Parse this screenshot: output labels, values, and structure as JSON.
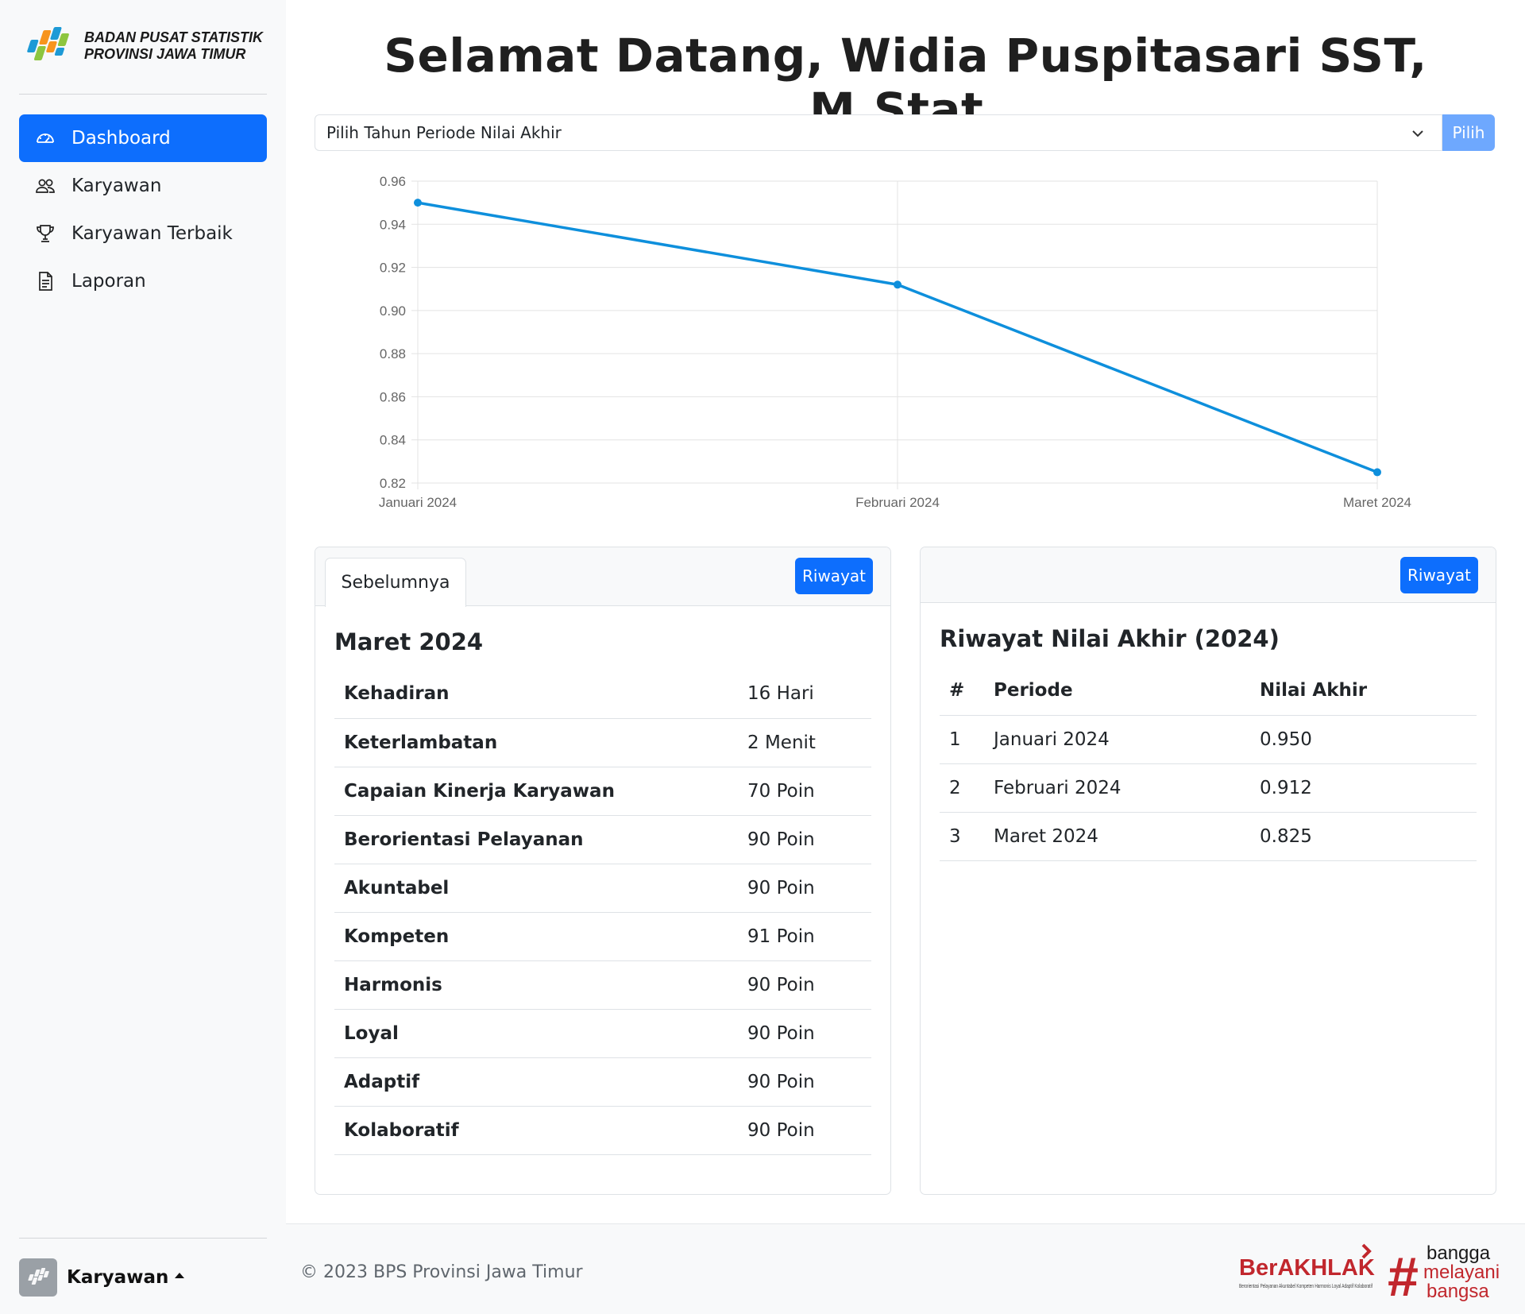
{
  "sidebar": {
    "brand_line1": "BADAN PUSAT STATISTIK",
    "brand_line2": "PROVINSI JAWA TIMUR",
    "nav": [
      {
        "label": "Dashboard",
        "icon": "speedometer-icon",
        "active": true
      },
      {
        "label": "Karyawan",
        "icon": "people-icon",
        "active": false
      },
      {
        "label": "Karyawan Terbaik",
        "icon": "trophy-icon",
        "active": false
      },
      {
        "label": "Laporan",
        "icon": "file-text-icon",
        "active": false
      }
    ],
    "user_label": "Karyawan"
  },
  "header": {
    "title": "Selamat Datang, Widia Puspitasari SST, M.Stat,"
  },
  "period_select": {
    "value": "Pilih Tahun Periode Nilai Akhir",
    "button_label": "Pilih"
  },
  "chart_data": {
    "type": "line",
    "categories": [
      "Januari 2024",
      "Februari 2024",
      "Maret 2024"
    ],
    "series": [
      {
        "values": [
          0.95,
          0.912,
          0.825
        ],
        "color": "#0e8fdc"
      }
    ],
    "yticks": [
      "0.96",
      "0.94",
      "0.92",
      "0.90",
      "0.88",
      "0.86",
      "0.84",
      "0.82"
    ],
    "ylim": [
      0.82,
      0.96
    ],
    "grid": true
  },
  "current_card": {
    "tab_label": "Sebelumnya",
    "button_label": "Riwayat",
    "title": "Maret 2024",
    "rows": [
      {
        "label": "Kehadiran",
        "value": "16 Hari"
      },
      {
        "label": "Keterlambatan",
        "value": "2 Menit"
      },
      {
        "label": "Capaian Kinerja Karyawan",
        "value": "70 Poin"
      },
      {
        "label": "Berorientasi Pelayanan",
        "value": "90 Poin"
      },
      {
        "label": "Akuntabel",
        "value": "90 Poin"
      },
      {
        "label": "Kompeten",
        "value": "91 Poin"
      },
      {
        "label": "Harmonis",
        "value": "90 Poin"
      },
      {
        "label": "Loyal",
        "value": "90 Poin"
      },
      {
        "label": "Adaptif",
        "value": "90 Poin"
      },
      {
        "label": "Kolaboratif",
        "value": "90 Poin"
      }
    ]
  },
  "history_card": {
    "button_label": "Riwayat",
    "title": "Riwayat Nilai Akhir (2024)",
    "columns": [
      "#",
      "Periode",
      "Nilai Akhir"
    ],
    "rows": [
      {
        "no": "1",
        "periode": "Januari 2024",
        "nilai": "0.950"
      },
      {
        "no": "2",
        "periode": "Februari 2024",
        "nilai": "0.912"
      },
      {
        "no": "3",
        "periode": "Maret 2024",
        "nilai": "0.825"
      }
    ]
  },
  "footer": {
    "copyright": "© 2023 BPS Provinsi Jawa Timur",
    "logo1_text": "BerAKHLAK",
    "logo1_tagline": "Berorientasi Pelayanan Akuntabel Kompeten Harmonis Loyal Adaptif Kolaboratif",
    "logo2_lines": [
      "bangga",
      "melayani",
      "bangsa"
    ]
  },
  "colors": {
    "primary": "#0d6efd",
    "primary_light": "#6ea8fe",
    "chart_line": "#0e8fdc",
    "brand_red": "#c1272d"
  }
}
